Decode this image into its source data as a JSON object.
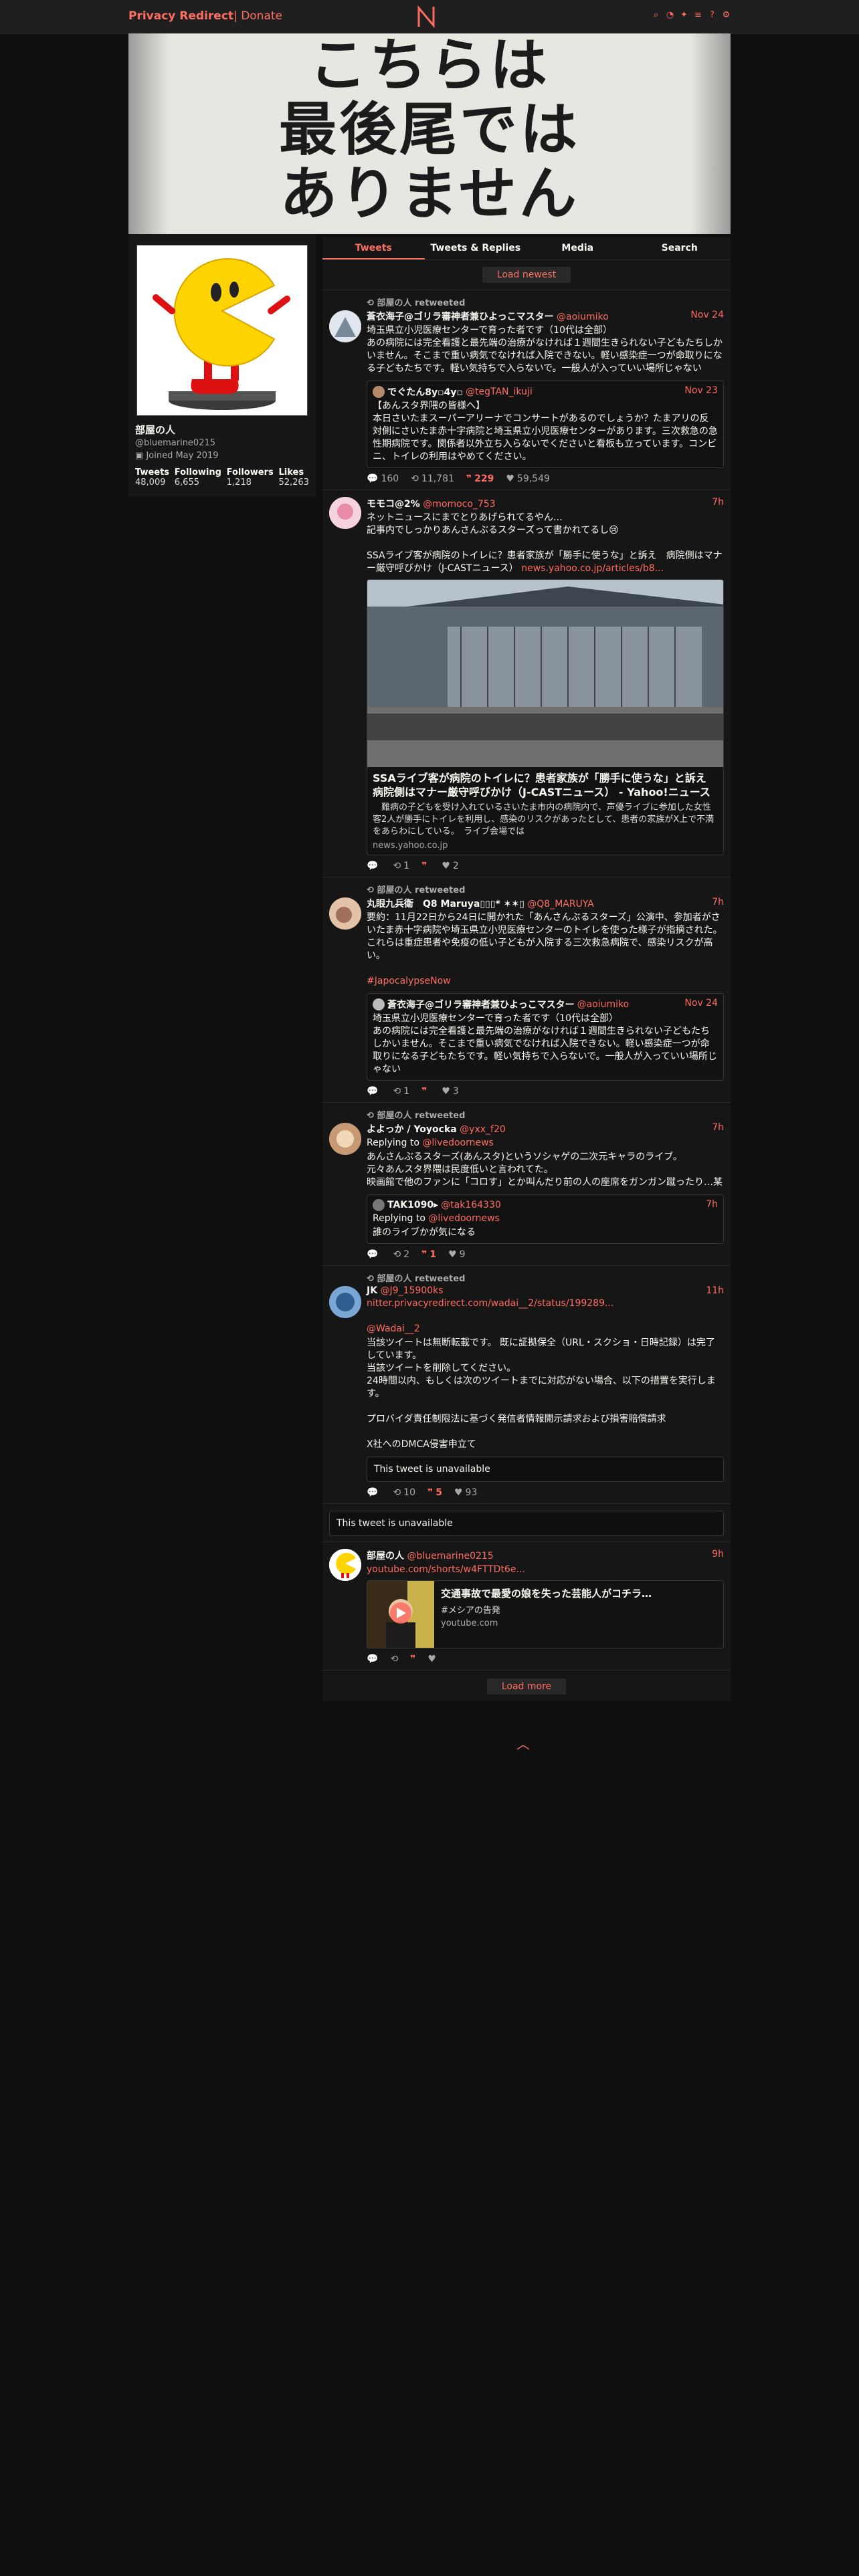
{
  "navbar": {
    "brand": "Privacy Redirect",
    "separator": "|",
    "donate": "Donate",
    "icons": [
      "search-icon",
      "rss-icon",
      "twitter-icon",
      "list-icon",
      "help-icon",
      "settings-icon"
    ]
  },
  "banner": {
    "line1": "こちらは",
    "line2": "最後尾では",
    "line3": "ありません"
  },
  "profile": {
    "name": "部屋の人",
    "handle": "@bluemarine0215",
    "joined": "Joined May 2019",
    "stats": [
      {
        "label": "Tweets",
        "value": "48,009"
      },
      {
        "label": "Following",
        "value": "6,655"
      },
      {
        "label": "Followers",
        "value": "1,218"
      },
      {
        "label": "Likes",
        "value": "52,263"
      }
    ]
  },
  "tabs": [
    "Tweets",
    "Tweets & Replies",
    "Media",
    "Search"
  ],
  "load_newest": "Load newest",
  "load_more": "Load more",
  "tweets": [
    {
      "retweet": "部屋の人 retweeted",
      "name": "蒼衣海子@ゴリラ審神者兼ひよっこマスター",
      "user": "@aoiumiko",
      "date": "Nov 24",
      "body": "埼玉県立小児医療センターで育った者です（10代は全部）\nあの病院には完全看護と最先端の治療がなければ１週間生きられない子どもたちしかいません。そこまで重い病気でなければ入院できない。軽い感染症一つが命取りになる子どもたちです。軽い気持ちで入らないで。一般人が入っていい場所じゃない",
      "quote": {
        "name": "でぐたん8y▫4y▫",
        "user": "@tegTAN_ikuji",
        "date": "Nov 23",
        "body": "【あんスタ界隈の皆様へ】\n本日さいたまスーパーアリーナでコンサートがあるのでしょうか？たまアリの反対側にさいたま赤十字病院と埼玉県立小児医療センターがあります。三次救急の急性期病院です。関係者以外立ち入らないでくださいと看板も立っています。コンビニ、トイレの利用はやめてください。"
      },
      "stats": {
        "replies": "160",
        "retweets": "11,781",
        "quotes": "229",
        "likes": "59,549"
      }
    },
    {
      "retweet": "",
      "name": "モモコ@2%",
      "user": "@momoco_753",
      "date": "7h",
      "body": "ネットニュースにまでとりあげられてるやん…\n記事内でしっかりあんさんぶるスターズって書かれてるし😢\n\nSSAライブ客が病院のトイレに？患者家族が「勝手に使うな」と訴え　病院側はマナー厳守呼びかけ（J-CASTニュース）",
      "link": "news.yahoo.co.jp/articles/b8...",
      "card": {
        "title": "SSAライブ客が病院のトイレに？患者家族が「勝手に使うな」と訴え　病院側はマナー厳守呼びかけ（J-CASTニュース） - Yahoo!ニュース",
        "desc": "　難病の子どもを受け入れているさいたま市内の病院内で、声優ライブに参加した女性客2人が勝手にトイレを利用し、感染のリスクがあったとして、患者の家族がX上で不満をあらわにしている。　ライブ会場では",
        "source": "news.yahoo.co.jp"
      },
      "stats": {
        "replies": "",
        "retweets": "1",
        "quotes": "",
        "likes": "2"
      }
    },
    {
      "retweet": "部屋の人 retweeted",
      "name": "丸眼九兵衛　Q8 Maruya▯▯▯* ✶✶▯",
      "user": "@Q8_MARUYA",
      "date": "7h",
      "body": "要約：11月22日から24日に開かれた「あんさんぶるスターズ」公演中、参加者がさいたま赤十字病院や埼玉県立小児医療センターのトイレを使った様子が指摘された。これらは重症患者や免疫の低い子どもが入院する三次救急病院で、感染リスクが高い。",
      "hashtag": "#JapocalypseNow",
      "quote": {
        "name": "蒼衣海子@ゴリラ審神者兼ひよっこマスター",
        "user": "@aoiumiko",
        "date": "Nov 24",
        "body": "埼玉県立小児医療センターで育った者です（10代は全部）\nあの病院には完全看護と最先端の治療がなければ１週間生きられない子どもたちしかいません。そこまで重い病気でなければ入院できない。軽い感染症一つが命取りになる子どもたちです。軽い気持ちで入らないで。一般人が入っていい場所じゃない"
      },
      "stats": {
        "replies": "",
        "retweets": "1",
        "quotes": "",
        "likes": "3"
      }
    },
    {
      "retweet": "部屋の人 retweeted",
      "name": "よよっか / Yoyocka",
      "user": "@yxx_f20",
      "date": "7h",
      "replying": "Replying to",
      "reply_to": "@livedoornews",
      "body": "あんさんぶるスターズ(あんスタ)というソシャゲの二次元キャラのライブ。\n元々あんスタ界隈は民度低いと言われてた。\n映画館で他のファンに「コロす」とか叫んだり前の人の座席をガンガン蹴ったり…某",
      "quote": {
        "name": "TAK1090▸",
        "user": "@tak164330",
        "date": "7h",
        "replying": "Replying to",
        "reply_to": "@livedoornews",
        "body": "誰のライブかが気になる"
      },
      "stats": {
        "replies": "",
        "retweets": "2",
        "quotes": "1",
        "likes": "9"
      }
    },
    {
      "retweet": "部屋の人 retweeted",
      "name": "JK",
      "user": "@J9_15900ks",
      "date": "11h",
      "link": "nitter.privacyredirect.com/wadai__2/status/199289...",
      "mention": "@Wadai__2",
      "body": "当該ツイートは無断転載です。 既に証拠保全（URL・スクショ・日時記録）は完了しています。\n当該ツイートを削除してください。\n24時間以内、もしくは次のツイートまでに対応がない場合、以下の措置を実行します。\n\nプロバイダ責任制限法に基づく発信者情報開示請求および損害賠償請求\n\nX社へのDMCA侵害申立て",
      "unavailable": "This tweet is unavailable",
      "stats": {
        "replies": "",
        "retweets": "10",
        "quotes": "5",
        "likes": "93"
      }
    },
    {
      "unavailable_only": "This tweet is unavailable"
    },
    {
      "retweet": "",
      "name": "部屋の人",
      "user": "@bluemarine0215",
      "date": "9h",
      "link": "youtube.com/shorts/w4FTTDt6e...",
      "yt": {
        "title": "交通事故で最愛の娘を失った芸能人がコチラ…",
        "sub": "#メシアの告発",
        "source": "youtube.com"
      },
      "stats": {
        "replies": "",
        "retweets": "",
        "quotes": "",
        "likes": ""
      }
    }
  ],
  "colors": {
    "accent": "#ff6c60",
    "bg": "#0f0f0f",
    "panel": "#161616"
  }
}
